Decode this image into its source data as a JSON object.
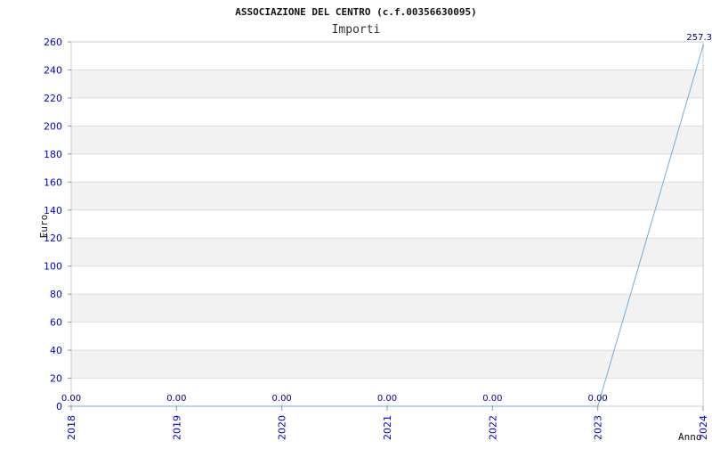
{
  "chart_data": {
    "type": "line",
    "title": "ASSOCIAZIONE DEL CENTRO (c.f.00356630095)",
    "subtitle": "Importi",
    "xlabel": "Anno",
    "ylabel": "Euro",
    "x": [
      "2018",
      "2019",
      "2020",
      "2021",
      "2022",
      "2023",
      "2024"
    ],
    "series": [
      {
        "values": [
          0,
          0,
          0,
          0,
          0,
          0,
          257.3
        ],
        "labels": [
          "0.00",
          "0.00",
          "0.00",
          "0.00",
          "0.00",
          "0.00",
          "257.3"
        ],
        "color": "#6aaee6"
      }
    ],
    "ylim": [
      0,
      260
    ],
    "yticks": [
      0,
      20,
      40,
      60,
      80,
      100,
      120,
      140,
      160,
      180,
      200,
      220,
      240,
      260
    ],
    "grid": true,
    "band_color": "#f2f2f2",
    "tick_color": "#0000cc",
    "data_label_color": "#000080"
  }
}
